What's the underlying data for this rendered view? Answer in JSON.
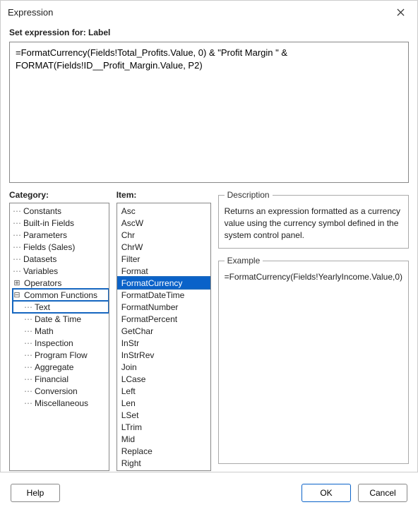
{
  "dialog": {
    "title": "Expression"
  },
  "label_row": {
    "text": "Set expression for: Label"
  },
  "expression": {
    "value": "=FormatCurrency(Fields!Total_Profits.Value, 0) & \"Profit Margin \" & FORMAT(Fields!ID__Profit_Margin.Value, P2)"
  },
  "labels": {
    "category": "Category:",
    "item": "Item:",
    "description": "Description",
    "example": "Example"
  },
  "category_tree": {
    "top": [
      {
        "label": "Constants"
      },
      {
        "label": "Built-in Fields"
      },
      {
        "label": "Parameters"
      },
      {
        "label": "Fields (Sales)"
      },
      {
        "label": "Datasets"
      },
      {
        "label": "Variables"
      }
    ],
    "operators_label": "Operators",
    "common_functions_label": "Common Functions",
    "functions": [
      {
        "label": "Text"
      },
      {
        "label": "Date & Time"
      },
      {
        "label": "Math"
      },
      {
        "label": "Inspection"
      },
      {
        "label": "Program Flow"
      },
      {
        "label": "Aggregate"
      },
      {
        "label": "Financial"
      },
      {
        "label": "Conversion"
      },
      {
        "label": "Miscellaneous"
      }
    ]
  },
  "item_list": [
    "Asc",
    "AscW",
    "Chr",
    "ChrW",
    "Filter",
    "Format",
    "FormatCurrency",
    "FormatDateTime",
    "FormatNumber",
    "FormatPercent",
    "GetChar",
    "InStr",
    "InStrRev",
    "Join",
    "LCase",
    "Left",
    "Len",
    "LSet",
    "LTrim",
    "Mid",
    "Replace",
    "Right"
  ],
  "item_selected": "FormatCurrency",
  "description": {
    "text": "Returns an expression formatted as a currency value using the currency symbol defined in the system control panel."
  },
  "example": {
    "text": "=FormatCurrency(Fields!YearlyIncome.Value,0)"
  },
  "buttons": {
    "help": "Help",
    "ok": "OK",
    "cancel": "Cancel"
  }
}
